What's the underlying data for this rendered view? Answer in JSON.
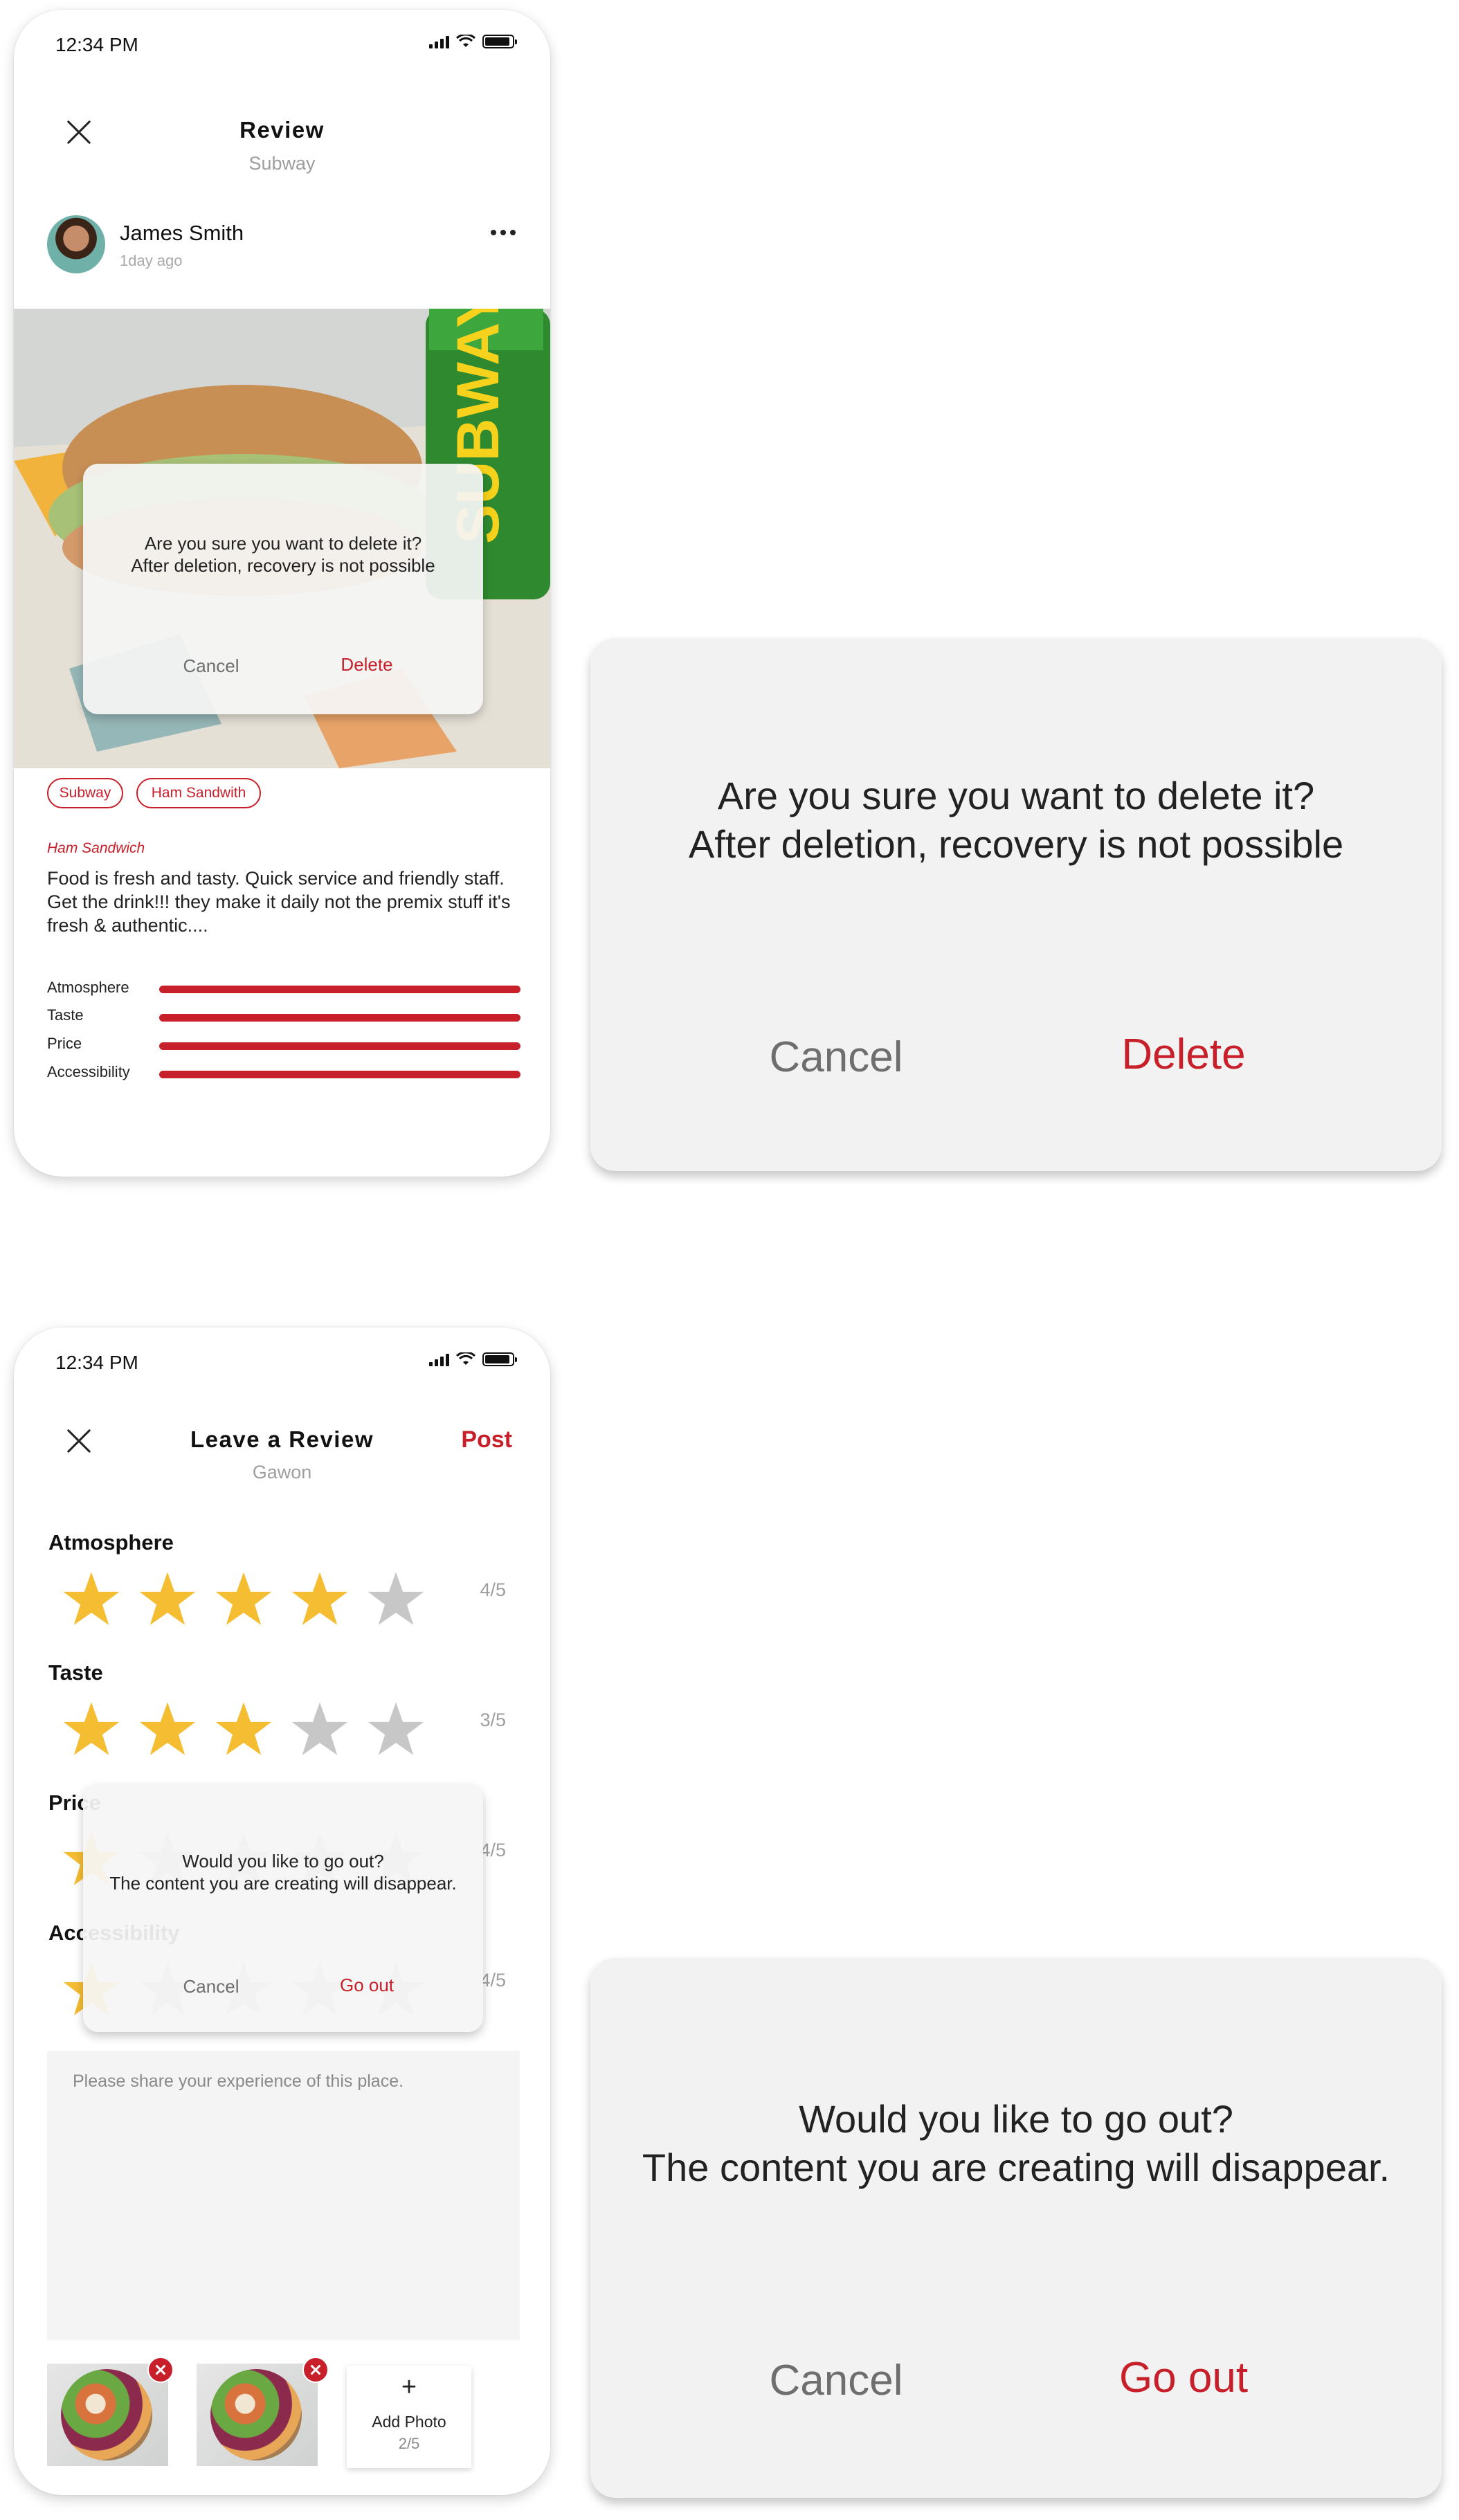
{
  "colors": {
    "accent": "#c8202a",
    "star_filled": "#f5bd32",
    "star_empty": "#c7c7c7",
    "dialog_bg": "#f2f2f2"
  },
  "review_screen": {
    "status": {
      "time": "12:34 PM"
    },
    "header": {
      "title": "Review",
      "subtitle": "Subway"
    },
    "user": {
      "name": "James Smith",
      "time_ago": "1day ago"
    },
    "photo": {
      "brand_text": "SUBWAY"
    },
    "tags": [
      "Subway",
      "Ham Sandwith"
    ],
    "menu_item": "Ham Sandwich",
    "review_text": "Food is fresh and tasty. Quick service and friendly staff. Get the drink!!! they make it daily not the premix stuff it's fresh & authentic....",
    "ratings": [
      {
        "label": "Atmosphere",
        "fraction": 1.0
      },
      {
        "label": "Taste",
        "fraction": 1.0
      },
      {
        "label": "Price",
        "fraction": 1.0
      },
      {
        "label": "Accessibility",
        "fraction": 1.0
      }
    ]
  },
  "delete_dialog": {
    "line1": "Are you sure you want to delete it?",
    "line2": "After deletion, recovery is not possible",
    "cancel_label": "Cancel",
    "delete_label": "Delete"
  },
  "leave_review_screen": {
    "status": {
      "time": "12:34 PM"
    },
    "header": {
      "title": "Leave a Review",
      "subtitle": "Gawon",
      "post_label": "Post"
    },
    "categories": [
      {
        "label": "Atmosphere",
        "stars": 4,
        "score": "4/5"
      },
      {
        "label": "Taste",
        "stars": 3,
        "score": "3/5"
      },
      {
        "label": "Price",
        "stars": 1,
        "score": "4/5"
      },
      {
        "label": "Accessibility",
        "stars": 1,
        "score": "4/5"
      }
    ],
    "textarea_placeholder": "Please share your experience of this place.",
    "add_photo": {
      "label": "Add Photo",
      "count": "2/5"
    }
  },
  "go_out_dialog": {
    "line1": "Would you like to go out?",
    "line2": "The content you are creating will disappear.",
    "cancel_label": "Cancel",
    "go_out_label": "Go out"
  }
}
